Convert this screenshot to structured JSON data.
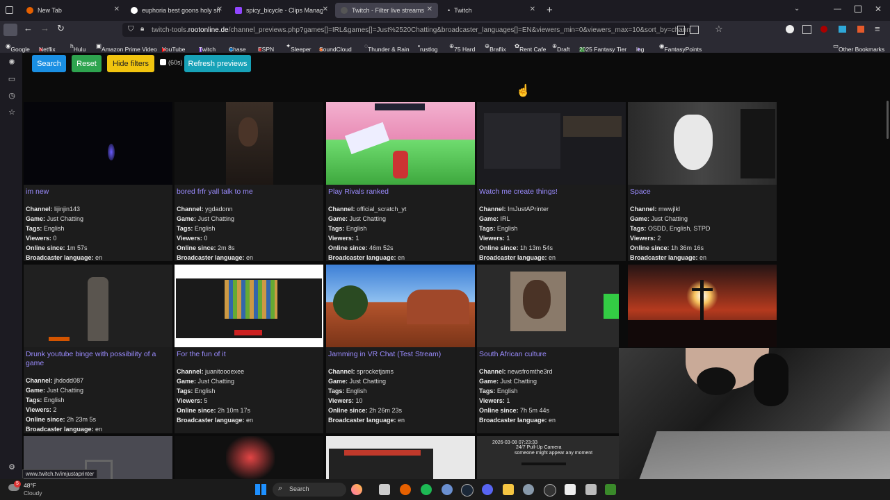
{
  "tabs": [
    "New Tab",
    "euphoria best goons holy shbit",
    "spicy_bicycle - Clips Manager -",
    "Twitch - Filter live streams",
    "Twitch"
  ],
  "url": {
    "prefix": "twitch-tools.",
    "domain": "rootonline.de",
    "path": "/channel_previews.php?games[]=IRL&games[]=Just%2520Chatting&broadcaster_languages[]=EN&viewers_min=0&viewers_max=10&sort_by=channelIdDesc"
  },
  "bookmarks": [
    "Google",
    "Netflix",
    "Hulu",
    "Amazon Prime Video",
    "YouTube",
    "Twitch",
    "Chase",
    "ESPN",
    "Sleeper",
    "SoundCloud",
    "Thunder & Rain",
    "rustlog",
    "75 Hard",
    "Braflix",
    "Rent Cafe",
    "Draft",
    "2025 Fantasy Tier",
    "log",
    "FantasyPoints",
    "Other Bookmarks"
  ],
  "buttons": {
    "search": "Search",
    "reset": "Reset",
    "hide_filters": "Hide filters",
    "timer": "(60s)",
    "refresh": "Refresh previews"
  },
  "labels": {
    "channel": "Channel:",
    "game": "Game:",
    "tags": "Tags:",
    "viewers": "Viewers:",
    "online": "Online since:",
    "lang": "Broadcaster language:"
  },
  "streams": [
    {
      "title": "im new",
      "channel": "lijinjin143",
      "game": "Just Chatting",
      "tags": "English",
      "viewers": "0",
      "online": "1m 57s",
      "lang": "en"
    },
    {
      "title": "bored frfr yall talk to me",
      "channel": "ygdadonn",
      "game": "Just Chatting",
      "tags": "English",
      "viewers": "0",
      "online": "2m 8s",
      "lang": "en"
    },
    {
      "title": "Play Rivals ranked",
      "channel": "official_scratch_yt",
      "game": "Just Chatting",
      "tags": "English",
      "viewers": "1",
      "online": "46m 52s",
      "lang": "en"
    },
    {
      "title": "Watch me create things!",
      "channel": "ImJustAPrinter",
      "game": "IRL",
      "tags": "English",
      "viewers": "1",
      "online": "1h 13m 54s",
      "lang": "en"
    },
    {
      "title": "Space",
      "channel": "mwwjlkl",
      "game": "Just Chatting",
      "tags": "OSDD, English, STPD",
      "viewers": "2",
      "online": "1h 36m 16s",
      "lang": "en"
    },
    {
      "title": "Drunk youtube binge with possibility of a game",
      "channel": "jhdodd087",
      "game": "Just Chatting",
      "tags": "English",
      "viewers": "2",
      "online": "2h 23m 5s",
      "lang": "en"
    },
    {
      "title": "For the fun of it",
      "channel": "juanitoooexee",
      "game": "Just Chatting",
      "tags": "English",
      "viewers": "5",
      "online": "2h 10m 17s",
      "lang": "en"
    },
    {
      "title": "Jamming in VR Chat (Test Stream)",
      "channel": "sprocketjams",
      "game": "Just Chatting",
      "tags": "English",
      "viewers": "10",
      "online": "2h 26m 23s",
      "lang": "en"
    },
    {
      "title": "South African culture",
      "channel": "newsfromthe3rd",
      "game": "Just Chatting",
      "tags": "English",
      "viewers": "1",
      "online": "7h 5m 44s",
      "lang": "en"
    }
  ],
  "thumb4_text": [
    "2026-03-08 07:23:33",
    "24/7 Pull-Up Camera",
    "someone might appear any moment"
  ],
  "status_url": "www.twitch.tv/imjustaprinter",
  "weather": {
    "temp": "48°F",
    "desc": "Cloudy",
    "badge": "5"
  },
  "taskbar_search": "Search"
}
